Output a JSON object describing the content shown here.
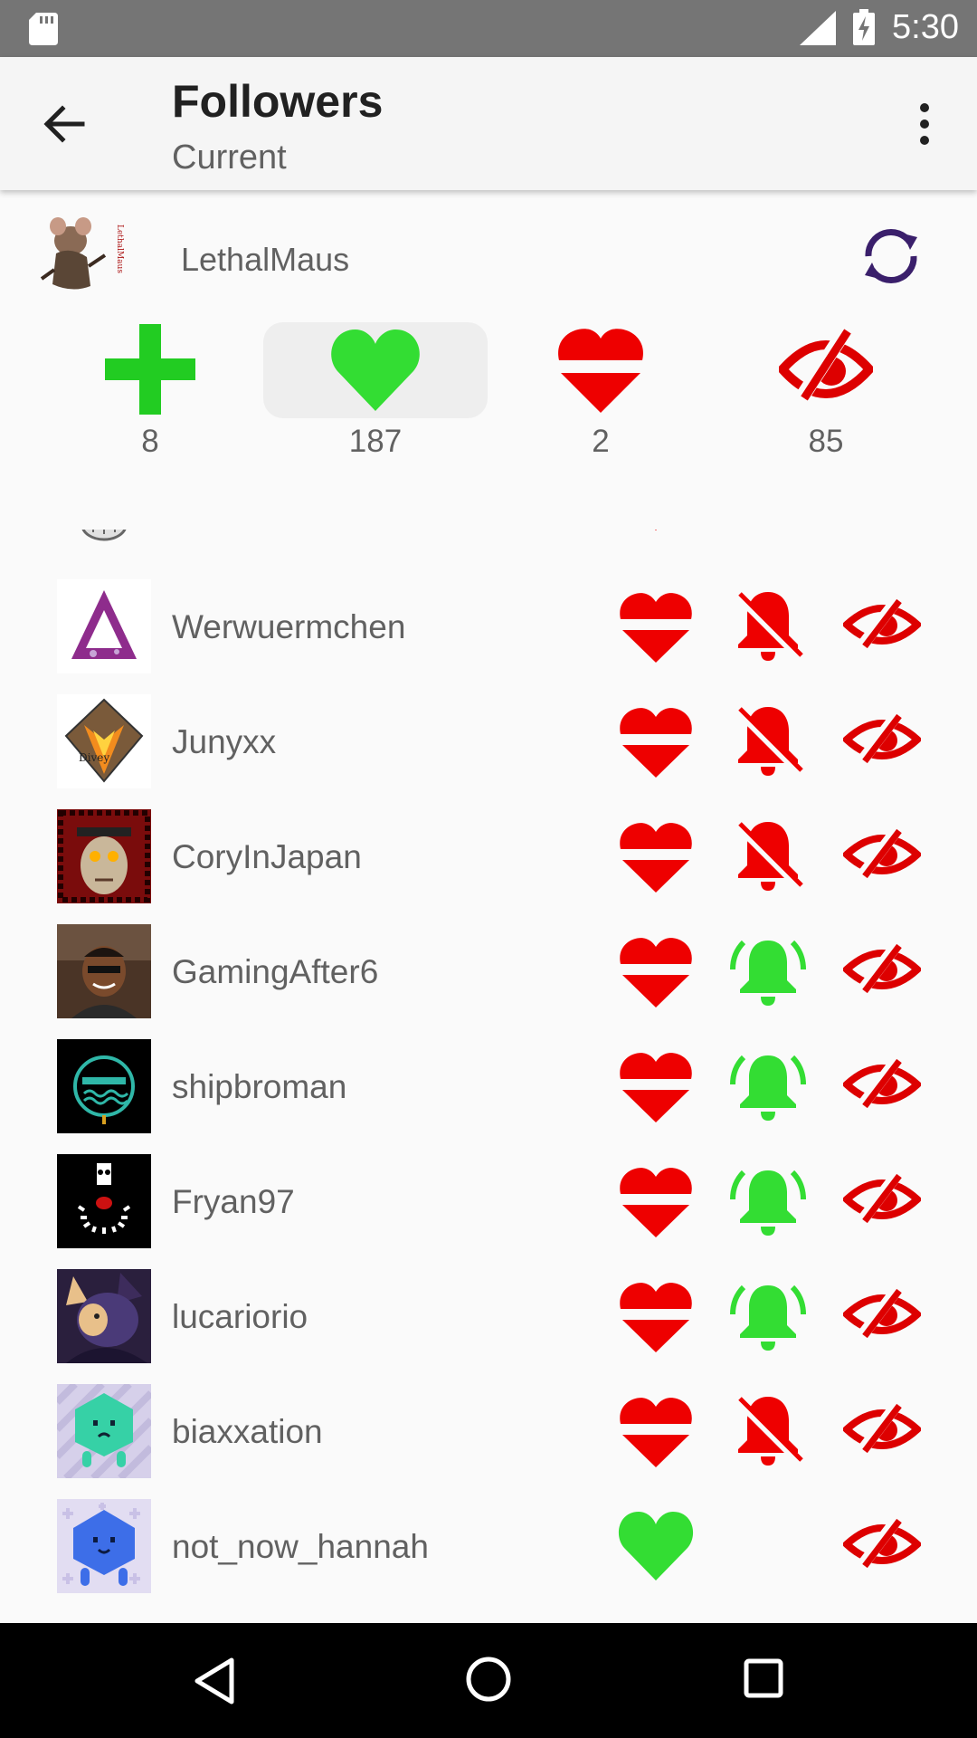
{
  "status_bar": {
    "time": "5:30"
  },
  "app_bar": {
    "title": "Followers",
    "subtitle": "Current"
  },
  "account": {
    "name": "LethalMaus"
  },
  "stats": [
    {
      "icon": "plus-icon",
      "count": "8",
      "color": "#22cc22"
    },
    {
      "icon": "heart-icon",
      "count": "187",
      "color": "#33dd33",
      "selected": true
    },
    {
      "icon": "unfollow-heart-icon",
      "count": "2",
      "color": "#ee0000"
    },
    {
      "icon": "eye-hidden-icon",
      "count": "85",
      "color": "#dd0000"
    }
  ],
  "followers": [
    {
      "name": "",
      "follow": "unfollow",
      "notify": "on",
      "visibility": "hidden",
      "partial": true
    },
    {
      "name": "Werwuermchen",
      "follow": "unfollow",
      "notify": "off",
      "visibility": "hidden"
    },
    {
      "name": "Junyxx",
      "follow": "unfollow",
      "notify": "off",
      "visibility": "hidden"
    },
    {
      "name": "CoryInJapan",
      "follow": "unfollow",
      "notify": "off",
      "visibility": "hidden"
    },
    {
      "name": "GamingAfter6",
      "follow": "unfollow",
      "notify": "on",
      "visibility": "hidden"
    },
    {
      "name": "shipbroman",
      "follow": "unfollow",
      "notify": "on",
      "visibility": "hidden"
    },
    {
      "name": "Fryan97",
      "follow": "unfollow",
      "notify": "on",
      "visibility": "hidden"
    },
    {
      "name": "lucariorio",
      "follow": "unfollow",
      "notify": "on",
      "visibility": "hidden"
    },
    {
      "name": "biaxxation",
      "follow": "unfollow",
      "notify": "off",
      "visibility": "hidden"
    },
    {
      "name": "not_now_hannah",
      "follow": "follow",
      "notify": "none",
      "visibility": "hidden"
    }
  ],
  "colors": {
    "status_bar": "#757575",
    "app_bar": "#f5f5f5",
    "green": "#33dd33",
    "red": "#ee0000",
    "refresh": "#3a1f6b"
  }
}
